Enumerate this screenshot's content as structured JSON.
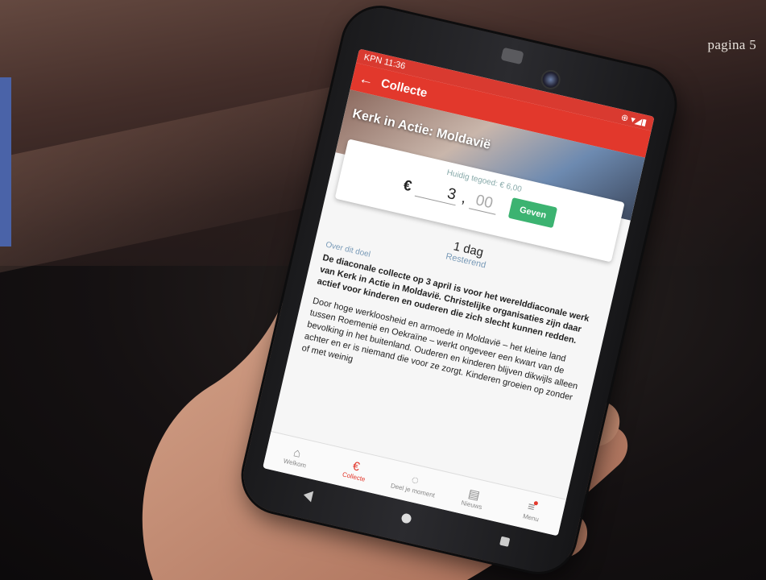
{
  "page_label": "pagina 5",
  "status_bar": {
    "carrier": "KPN",
    "time": "11:36",
    "icons": "⊕ ▾◢▮"
  },
  "app_bar": {
    "back_icon": "←",
    "title": "Collecte"
  },
  "hero": {
    "title": "Kerk in Actie: Moldavië"
  },
  "donation": {
    "balance_text": "Huidig tegoed: € 6,00",
    "currency": "€",
    "euros": "3",
    "separator": ",",
    "cents": "00",
    "give_label": "Geven"
  },
  "remaining": {
    "value": "1 dag",
    "label": "Resterend"
  },
  "about": {
    "section_label": "Over dit doel",
    "intro": "De diaconale collecte op 3 april is voor het werelddiaconale werk van Kerk in Actie in Moldavië. Christelijke organisaties zijn daar actief voor kinderen en ouderen die zich slecht kunnen redden.",
    "body": "Door hoge werkloosheid en armoede in Moldavië – het kleine land tussen Roemenië en Oekraïne – werkt ongeveer een kwart van de bevolking in het buitenland. Ouderen en kinderen blijven dikwijls alleen achter en er is niemand die voor ze zorgt. Kinderen groeien op zonder of met weinig"
  },
  "tabs": [
    {
      "icon": "⌂",
      "label": "Welkom"
    },
    {
      "icon": "€",
      "label": "Collecte"
    },
    {
      "icon": "◌",
      "label": "Deel je moment"
    },
    {
      "icon": "▤",
      "label": "Nieuws"
    },
    {
      "icon": "≡",
      "label": "Menu"
    }
  ],
  "colors": {
    "primary": "#e2382c",
    "give_button": "#3cb371",
    "page_accent": "#4a63a8"
  }
}
